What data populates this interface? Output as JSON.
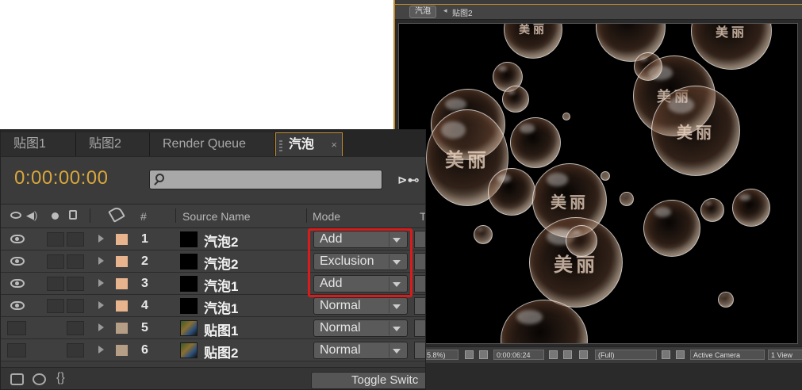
{
  "viewer": {
    "breadcrumb_active": "汽泡",
    "breadcrumb_separator": "◂",
    "breadcrumb_next": "贴图2",
    "bubble_text": "美丽",
    "controls": {
      "zoom": "5.8%)",
      "time": "0:00:06:24",
      "resolution": "(Full)",
      "camera": "Active Camera",
      "views": "1 View"
    }
  },
  "timeline": {
    "tabs": [
      {
        "label": "贴图1",
        "active": false
      },
      {
        "label": "贴图2",
        "active": false
      },
      {
        "label": "Render Queue",
        "active": false
      },
      {
        "label": "汽泡",
        "active": true
      }
    ],
    "tab_close": "×",
    "timecode": "0:00:00:00",
    "search_placeholder": "",
    "flow_icon": "⊳⊷",
    "columns": {
      "number": "#",
      "source_name": "Source Name",
      "mode": "Mode",
      "trkmat": "T"
    },
    "layers": [
      {
        "num": "1",
        "name": "汽泡2",
        "mode": "Add",
        "visible": true,
        "thumb": "solid",
        "label_color": "#e8b48e"
      },
      {
        "num": "2",
        "name": "汽泡2",
        "mode": "Exclusion",
        "visible": true,
        "thumb": "solid",
        "label_color": "#e8b48e"
      },
      {
        "num": "3",
        "name": "汽泡1",
        "mode": "Add",
        "visible": true,
        "thumb": "solid",
        "label_color": "#e8b48e"
      },
      {
        "num": "4",
        "name": "汽泡1",
        "mode": "Normal",
        "visible": true,
        "thumb": "solid",
        "label_color": "#e8b48e"
      },
      {
        "num": "5",
        "name": "贴图1",
        "mode": "Normal",
        "visible": false,
        "thumb": "comp",
        "label_color": "#b49f86"
      },
      {
        "num": "6",
        "name": "贴图2",
        "mode": "Normal",
        "visible": false,
        "thumb": "comp",
        "label_color": "#b49f86"
      }
    ],
    "toggle_label": "Toggle Switc"
  },
  "colors": {
    "accent": "#c08a2e",
    "timecode": "#d9a73b",
    "highlight": "#d81c1c"
  }
}
